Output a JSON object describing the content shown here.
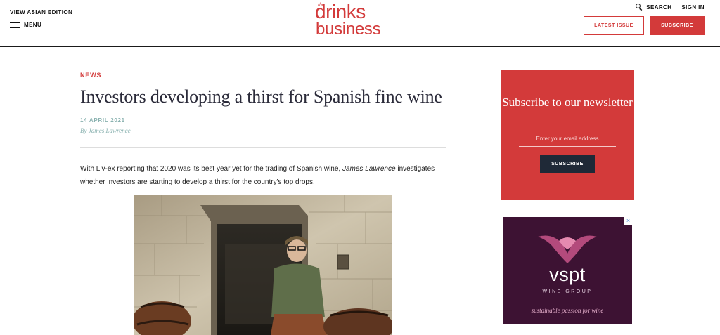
{
  "header": {
    "edition_link": "VIEW ASIAN EDITION",
    "menu_label": "MENU",
    "logo": {
      "the": "the",
      "line1": "drinks",
      "line2": "business"
    },
    "search_label": "SEARCH",
    "signin_label": "SIGN IN",
    "latest_issue_label": "LATEST ISSUE",
    "subscribe_label": "SUBSCRIBE"
  },
  "article": {
    "category": "NEWS",
    "headline": "Investors developing a thirst for Spanish fine wine",
    "date": "14 APRIL 2021",
    "byline": "By James Lawrence",
    "standfirst_before": "With Liv-ex reporting that 2020 was its best year yet for the trading of Spanish wine, ",
    "standfirst_author": "James Lawrence",
    "standfirst_after": " investigates whether investors are starting to develop a thirst for the country's top drops."
  },
  "newsletter": {
    "title": "Subscribe to our newsletter",
    "email_placeholder": "Enter your email address",
    "button_label": "SUBSCRIBE"
  },
  "ad": {
    "brand": "vspt",
    "subtitle": "WINE GROUP",
    "tagline": "sustainable passion for wine",
    "close_glyph": "×"
  },
  "colors": {
    "brand_red": "#d33a3a",
    "teal_meta": "#8ab2b0",
    "dark_button": "#1f2937",
    "ad_background": "#3d1233"
  },
  "icons": [
    "hamburger-icon",
    "search-icon",
    "ad-close-icon",
    "vspt-bird-logo"
  ]
}
